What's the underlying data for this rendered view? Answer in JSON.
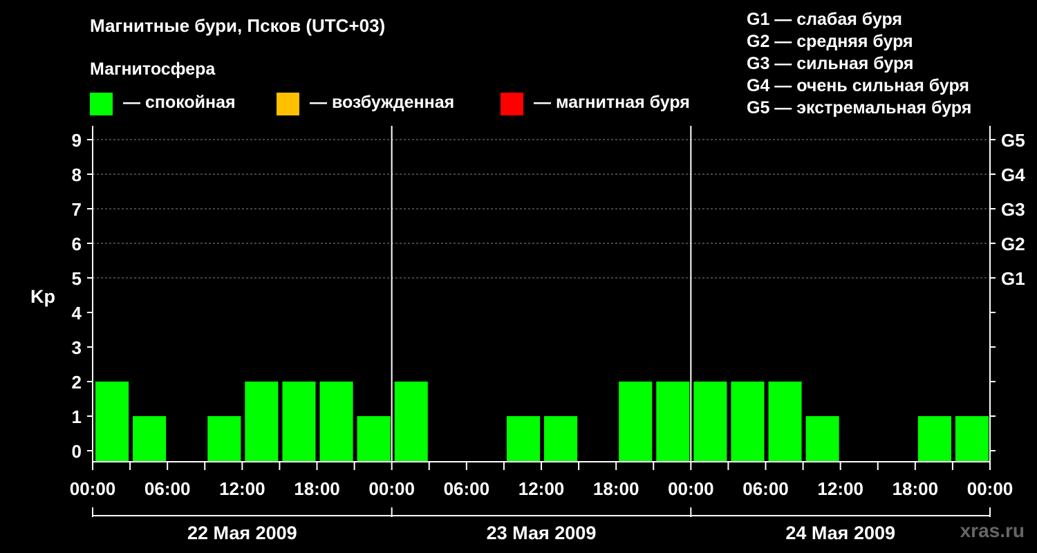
{
  "title": "Магнитные бури, Псков (UTC+03)",
  "magnetosphere_label": "Магнитосфера",
  "legend": [
    {
      "color": "#00ff00",
      "label": "— спокойная"
    },
    {
      "color": "#ffc000",
      "label": "— возбужденная"
    },
    {
      "color": "#ff0000",
      "label": "— магнитная буря"
    }
  ],
  "g_scale": [
    "G1 — слабая буря",
    "G2 — средняя буря",
    "G3 — сильная буря",
    "G4 — очень сильная буря",
    "G5 — экстремальная буря"
  ],
  "watermark": "xras.ru",
  "chart_data": {
    "type": "bar",
    "ylabel": "Kp",
    "ylim": [
      0,
      9
    ],
    "y_ticks": [
      "0",
      "1",
      "2",
      "3",
      "4",
      "5",
      "6",
      "7",
      "8",
      "9"
    ],
    "right_ticks": [
      {
        "y": 5,
        "label": "G1"
      },
      {
        "y": 6,
        "label": "G2"
      },
      {
        "y": 7,
        "label": "G3"
      },
      {
        "y": 8,
        "label": "G4"
      },
      {
        "y": 9,
        "label": "G5"
      }
    ],
    "x_tick_labels": [
      "00:00",
      "06:00",
      "12:00",
      "18:00",
      "00:00",
      "06:00",
      "12:00",
      "18:00",
      "00:00",
      "06:00",
      "12:00",
      "18:00",
      "00:00"
    ],
    "days": [
      "22 Мая 2009",
      "23 Мая 2009",
      "24 Мая 2009"
    ],
    "grid": "dashed horizontal",
    "bar_colors": {
      "quiet": "#00ff00",
      "active": "#ffc000",
      "storm": "#ff0000"
    },
    "series": [
      {
        "values": [
          2,
          1,
          0,
          1,
          2,
          2,
          2,
          1,
          2,
          0,
          0,
          1,
          1,
          0,
          2,
          2,
          2,
          2,
          2,
          1,
          0,
          0,
          1,
          1
        ]
      }
    ]
  }
}
